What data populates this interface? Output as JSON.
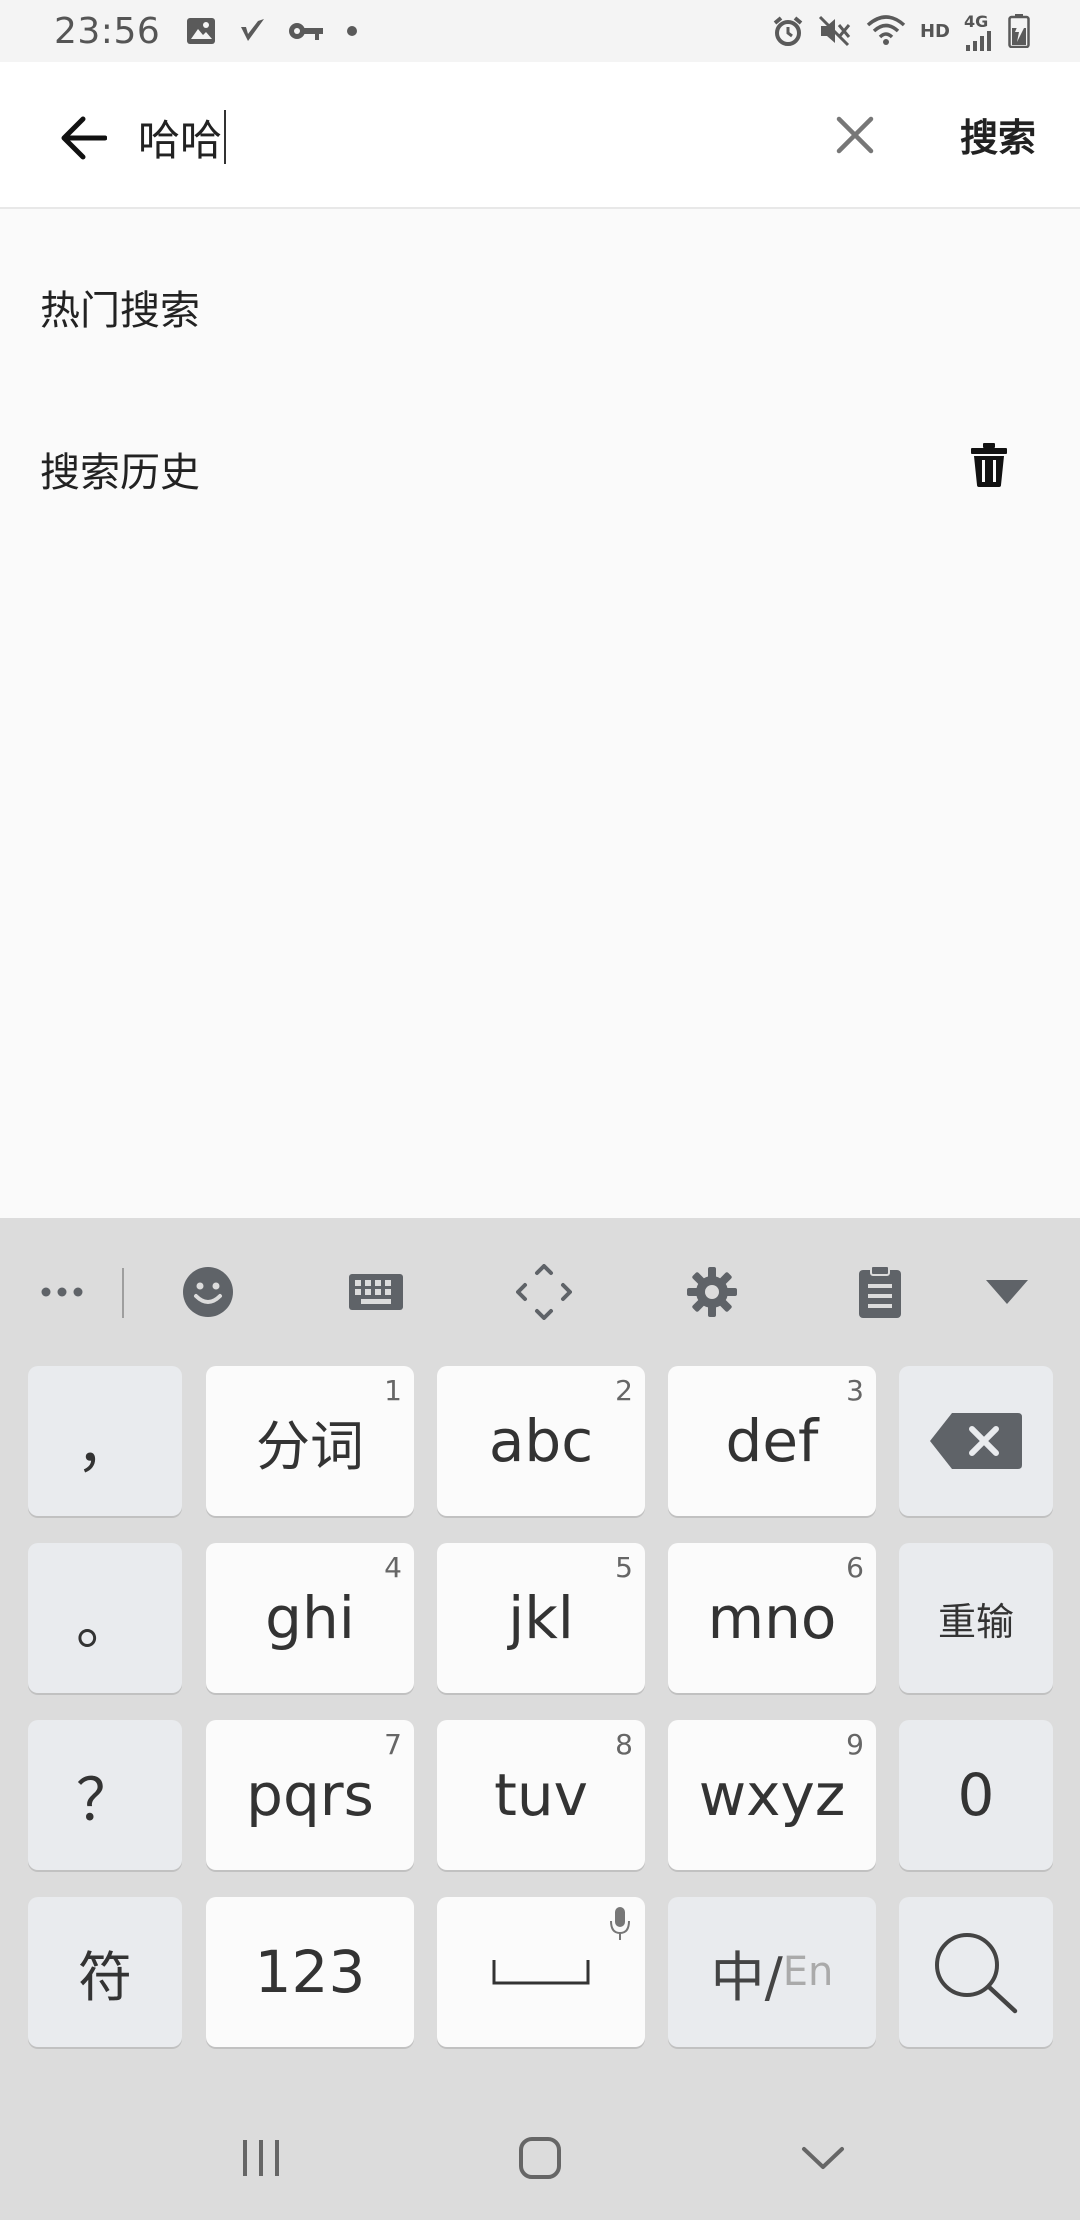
{
  "status_bar": {
    "time": "23:56",
    "hd_label": "HD",
    "network_label": "4G",
    "left_icons": [
      "image-icon",
      "check-icon",
      "key-icon",
      "dot-icon"
    ],
    "right_icons": [
      "alarm-icon",
      "mute-icon",
      "wifi-icon",
      "signal-icon",
      "battery-icon"
    ]
  },
  "search": {
    "value": "哈哈",
    "submit_label": "搜索"
  },
  "sections": {
    "hot_title": "热门搜索",
    "history_title": "搜索历史"
  },
  "keyboard": {
    "toolbar": [
      "more-icon",
      "emoji-icon",
      "keyboard-icon",
      "cursor-move-icon",
      "settings-icon",
      "clipboard-icon",
      "collapse-icon"
    ],
    "rows": [
      [
        {
          "label": "，",
          "num": ""
        },
        {
          "label": "分词",
          "num": "1"
        },
        {
          "label": "abc",
          "num": "2"
        },
        {
          "label": "def",
          "num": "3"
        }
      ],
      [
        {
          "label": "。",
          "num": ""
        },
        {
          "label": "ghi",
          "num": "4"
        },
        {
          "label": "jkl",
          "num": "5"
        },
        {
          "label": "mno",
          "num": "6"
        },
        {
          "label": "重输",
          "num": ""
        }
      ],
      [
        {
          "label": "？",
          "num": ""
        },
        {
          "label": "pqrs",
          "num": "7"
        },
        {
          "label": "tuv",
          "num": "8"
        },
        {
          "label": "wxyz",
          "num": "9"
        },
        {
          "label": "0",
          "num": ""
        }
      ],
      [
        {
          "label": "符",
          "num": ""
        },
        {
          "label": "123",
          "num": ""
        }
      ]
    ],
    "lang_primary": "中/",
    "lang_secondary": "En"
  },
  "colors": {
    "page_bg": "#fafafa",
    "keyboard_bg": "#dcdcdc",
    "key_light": "#fbfbfb",
    "key_dark": "#e9ebee",
    "icon_gray": "#5f6368"
  }
}
